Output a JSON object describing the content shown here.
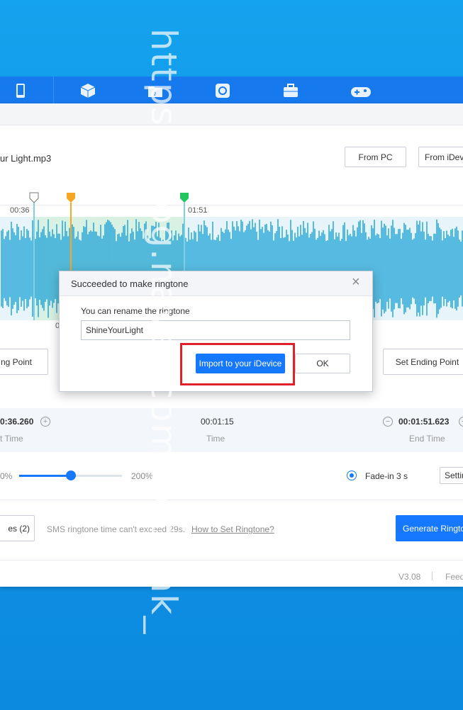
{
  "file": {
    "name_partial": "ur Light.mp3"
  },
  "buttons": {
    "from_pc": "From PC",
    "from_idevice": "From iDev"
  },
  "timeline": {
    "tick_left": "00:36",
    "tick_right": "01:51",
    "tick_bottom": "0"
  },
  "points": {
    "set_starting_point": "ng Point",
    "set_ending_point": "Set Ending Point"
  },
  "times": {
    "start_value": "0:36.260",
    "start_label": "t Time",
    "mid_value": "00:01:15",
    "mid_label": "Time",
    "end_value": "00:01:51.623",
    "end_label": "End Time"
  },
  "volume": {
    "min_label": "0%",
    "max_label": "200%",
    "level_fraction": 0.5
  },
  "fade": {
    "label": "Fade-in 3 s",
    "settings": "Settin"
  },
  "footer": {
    "btn_left": "es (2)",
    "sms_note": "SMS ringtone time can't exceed 29s.",
    "how_to": "How to Set Ringtone?",
    "generate": "Generate Ringto"
  },
  "status": {
    "version": "V3.08",
    "feedback": "Feed"
  },
  "dialog": {
    "title": "Succeeded to make ringtone",
    "rename_label": "You can rename the ringtone",
    "name_value": "ShineYourLight",
    "import_button": "Import to your iDevice",
    "ok_button": "OK",
    "close": "×"
  },
  "watermark": "https://blog.naver.com/nothink_",
  "colors": {
    "accent": "#1677ff",
    "highlight_box": "#e0202a",
    "wave": "#1aa1d6",
    "start_marker": "#f5a623",
    "end_marker": "#22c55e"
  },
  "nav_icons": [
    "phone-icon",
    "cube-icon",
    "folder-music-icon",
    "refresh-icon",
    "toolbox-icon",
    "gamepad-icon"
  ]
}
